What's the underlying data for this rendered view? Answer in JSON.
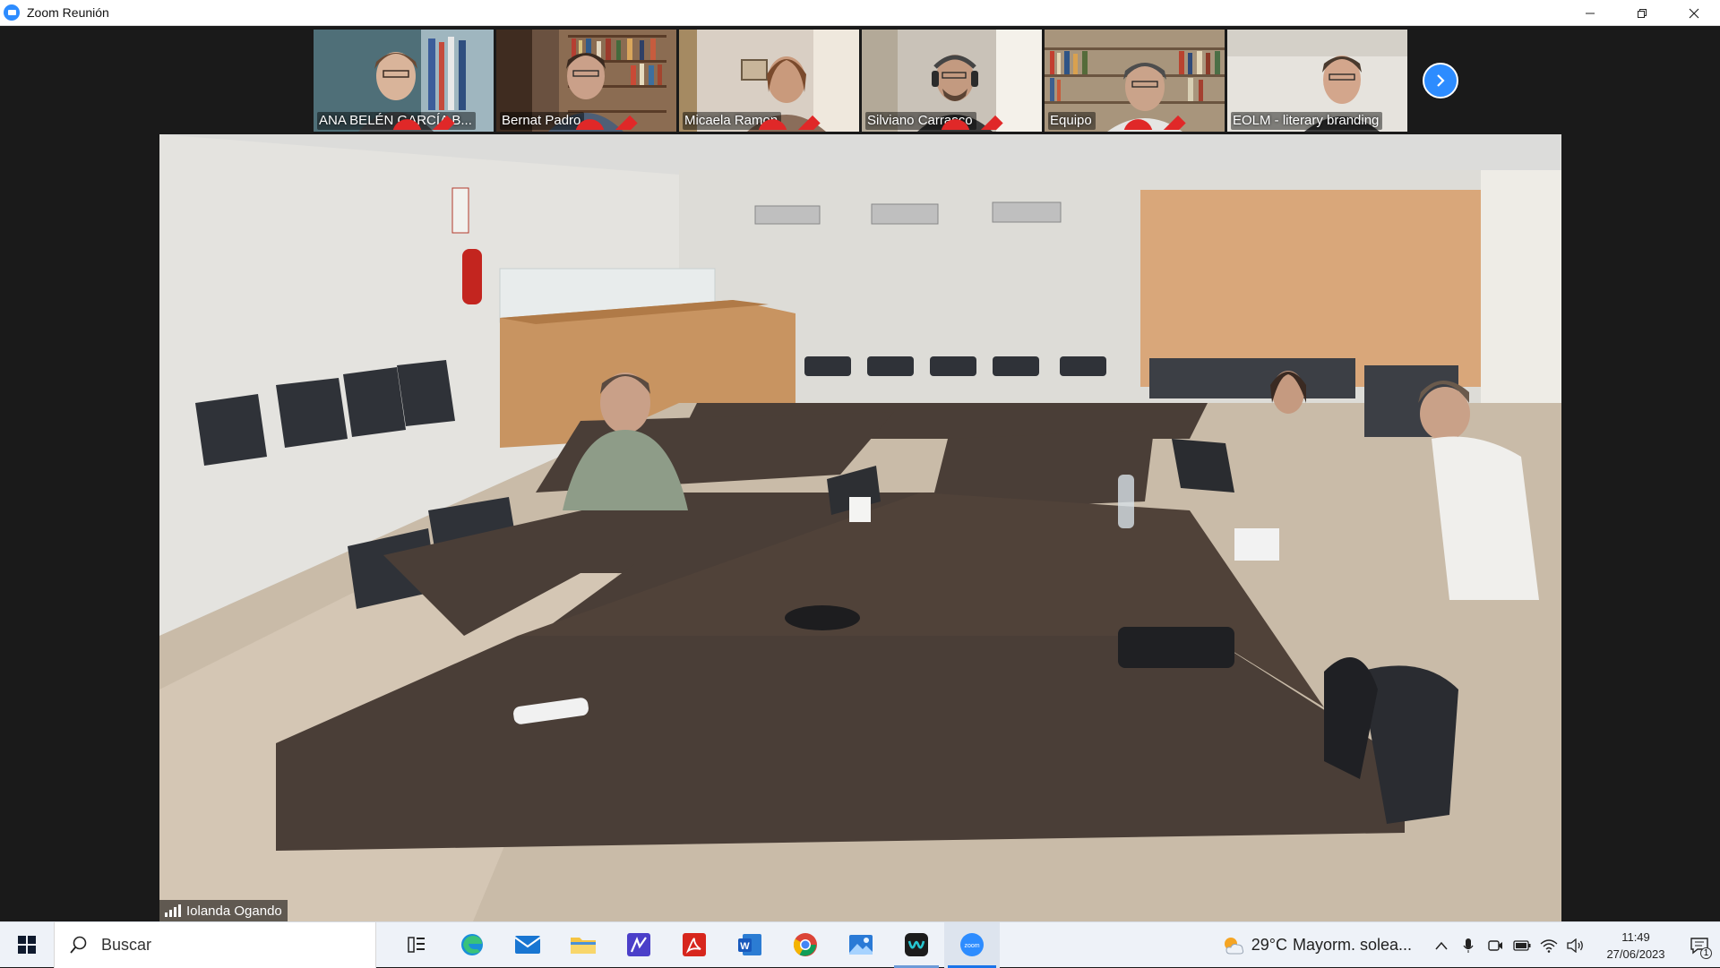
{
  "window": {
    "title": "Zoom Reunión",
    "controls": {
      "minimize": "—",
      "restore": "❐",
      "close": "✕"
    }
  },
  "gallery": {
    "participants": [
      {
        "name": "ANA BELÉN GARCÍA B...",
        "muted": true
      },
      {
        "name": "Bernat Padro",
        "muted": true
      },
      {
        "name": "Micaela Ramon",
        "muted": true
      },
      {
        "name": "Silviano Carrasco",
        "muted": true
      },
      {
        "name": "Equipo",
        "muted": true
      },
      {
        "name": "EOLM - literary branding",
        "muted": false
      }
    ],
    "next_page_icon": "chevron-right-icon"
  },
  "main_video": {
    "speaker_name": "Iolanda Ogando"
  },
  "taskbar": {
    "search_label": "Buscar",
    "apps": [
      "task-view",
      "edge",
      "mail",
      "file-explorer",
      "sketch-app",
      "acrobat",
      "word",
      "chrome",
      "photos",
      "webex",
      "zoom"
    ],
    "weather": {
      "temp": "29°C",
      "text": "Mayorm. solea..."
    },
    "clock": {
      "time": "11:49",
      "date": "27/06/2023"
    },
    "notifications": "1"
  },
  "colors": {
    "zoom_blue": "#2d8cff",
    "stage_bg": "#1a1a1a",
    "taskbar_bg": "#eef2f8",
    "mute_red": "#e02828"
  }
}
